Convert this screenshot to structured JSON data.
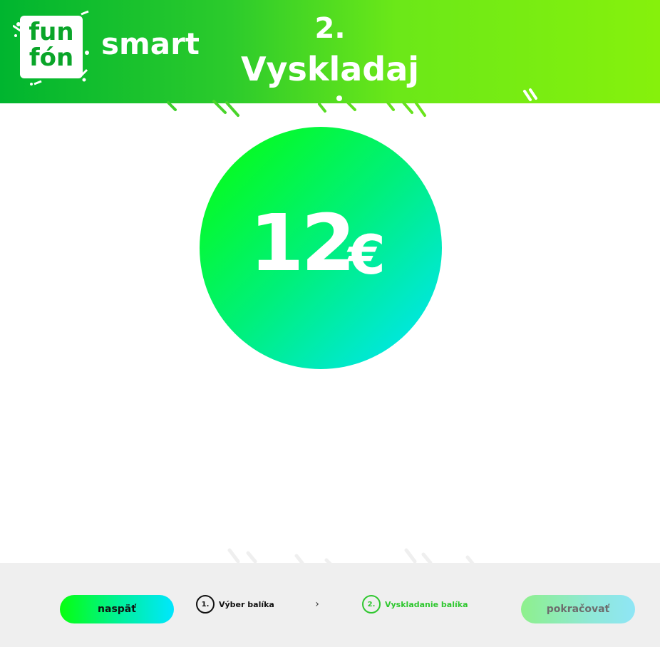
{
  "header": {
    "logo_line1": "fun",
    "logo_line2": "fón",
    "brand_word": "smart",
    "step_number": "2.",
    "step_title": "Vyskladaj"
  },
  "price": {
    "amount": "12",
    "currency": "€"
  },
  "footer": {
    "back_label": "naspäť",
    "next_label": "pokračovať",
    "steps": [
      {
        "number": "1.",
        "label": "Výber balíka"
      },
      {
        "number": "2.",
        "label": "Vyskladanie balíka"
      }
    ],
    "separator": "›"
  },
  "colors": {
    "accent_green": "#2fc72f",
    "header_gradient_start": "#00b52f",
    "header_gradient_end": "#86f10c",
    "circle_gradient_start": "#08ff08",
    "circle_gradient_end": "#00e4ff"
  },
  "icons": {
    "separator_icon": "chevron-right-icon"
  }
}
